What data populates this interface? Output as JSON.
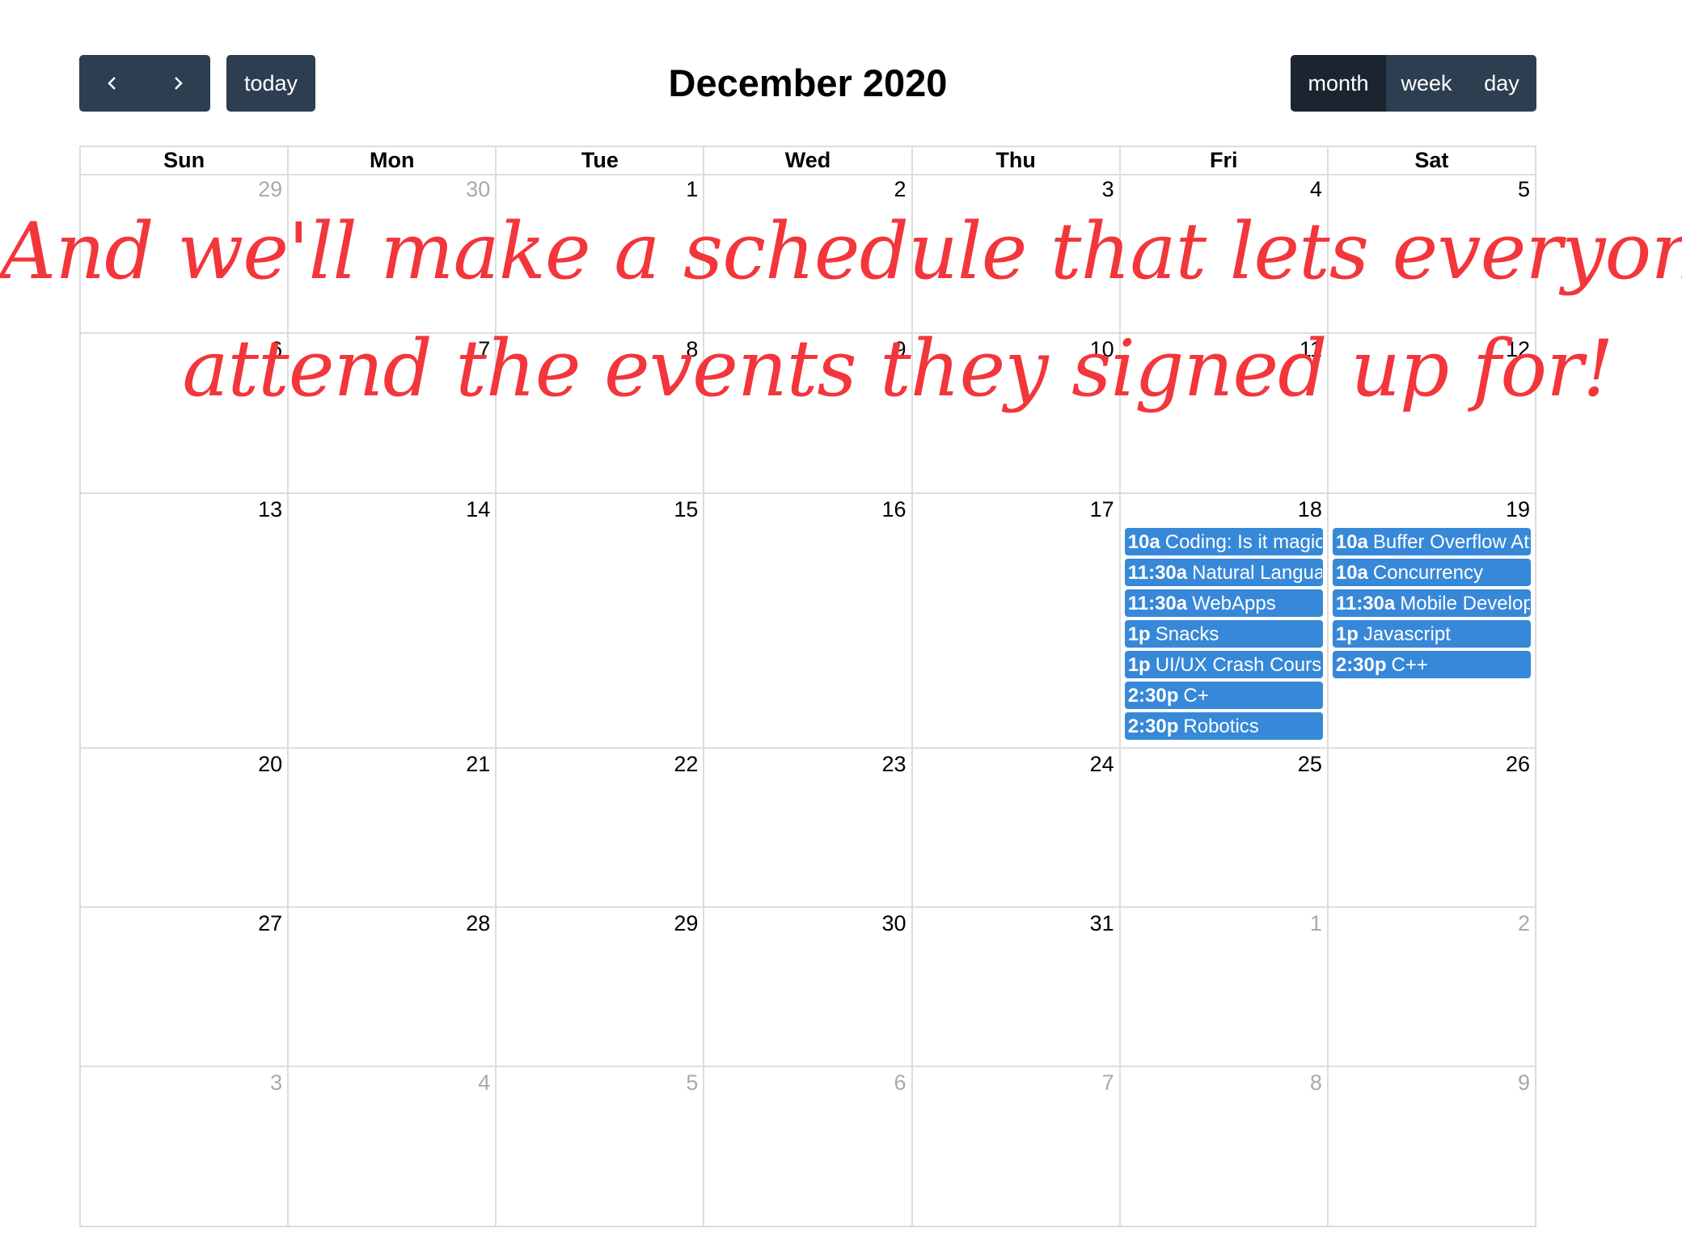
{
  "toolbar": {
    "prev_icon": "chevron-left-icon",
    "next_icon": "chevron-right-icon",
    "today_label": "today",
    "title": "December 2020",
    "views": [
      "month",
      "week",
      "day"
    ],
    "active_view": "month"
  },
  "day_headers": [
    "Sun",
    "Mon",
    "Tue",
    "Wed",
    "Thu",
    "Fri",
    "Sat"
  ],
  "weeks": [
    [
      {
        "num": "29",
        "other": true
      },
      {
        "num": "30",
        "other": true
      },
      {
        "num": "1"
      },
      {
        "num": "2"
      },
      {
        "num": "3"
      },
      {
        "num": "4"
      },
      {
        "num": "5"
      }
    ],
    [
      {
        "num": "6"
      },
      {
        "num": "7"
      },
      {
        "num": "8"
      },
      {
        "num": "9"
      },
      {
        "num": "10"
      },
      {
        "num": "11"
      },
      {
        "num": "12"
      }
    ],
    [
      {
        "num": "13"
      },
      {
        "num": "14"
      },
      {
        "num": "15"
      },
      {
        "num": "16"
      },
      {
        "num": "17"
      },
      {
        "num": "18",
        "events": [
          {
            "time": "10a",
            "title": "Coding: Is it magic"
          },
          {
            "time": "11:30a",
            "title": "Natural Langua"
          },
          {
            "time": "11:30a",
            "title": "WebApps"
          },
          {
            "time": "1p",
            "title": "Snacks"
          },
          {
            "time": "1p",
            "title": "UI/UX Crash Course"
          },
          {
            "time": "2:30p",
            "title": "C+"
          },
          {
            "time": "2:30p",
            "title": "Robotics"
          }
        ]
      },
      {
        "num": "19",
        "events": [
          {
            "time": "10a",
            "title": "Buffer Overflow Att"
          },
          {
            "time": "10a",
            "title": "Concurrency"
          },
          {
            "time": "11:30a",
            "title": "Mobile Develop"
          },
          {
            "time": "1p",
            "title": "Javascript"
          },
          {
            "time": "2:30p",
            "title": "C++"
          }
        ]
      }
    ],
    [
      {
        "num": "20"
      },
      {
        "num": "21"
      },
      {
        "num": "22"
      },
      {
        "num": "23"
      },
      {
        "num": "24"
      },
      {
        "num": "25"
      },
      {
        "num": "26"
      }
    ],
    [
      {
        "num": "27"
      },
      {
        "num": "28"
      },
      {
        "num": "29"
      },
      {
        "num": "30"
      },
      {
        "num": "31"
      },
      {
        "num": "1",
        "other": true
      },
      {
        "num": "2",
        "other": true
      }
    ],
    [
      {
        "num": "3",
        "other": true
      },
      {
        "num": "4",
        "other": true
      },
      {
        "num": "5",
        "other": true
      },
      {
        "num": "6",
        "other": true
      },
      {
        "num": "7",
        "other": true
      },
      {
        "num": "8",
        "other": true
      },
      {
        "num": "9",
        "other": true
      }
    ]
  ],
  "overlay": {
    "line1": "And we'll make a schedule that lets everyone",
    "line2": "attend the events they signed up for!",
    "color": "#f2363b"
  },
  "colors": {
    "button": "#2c3e50",
    "button_active": "#1a252f",
    "event": "#3788d8"
  }
}
